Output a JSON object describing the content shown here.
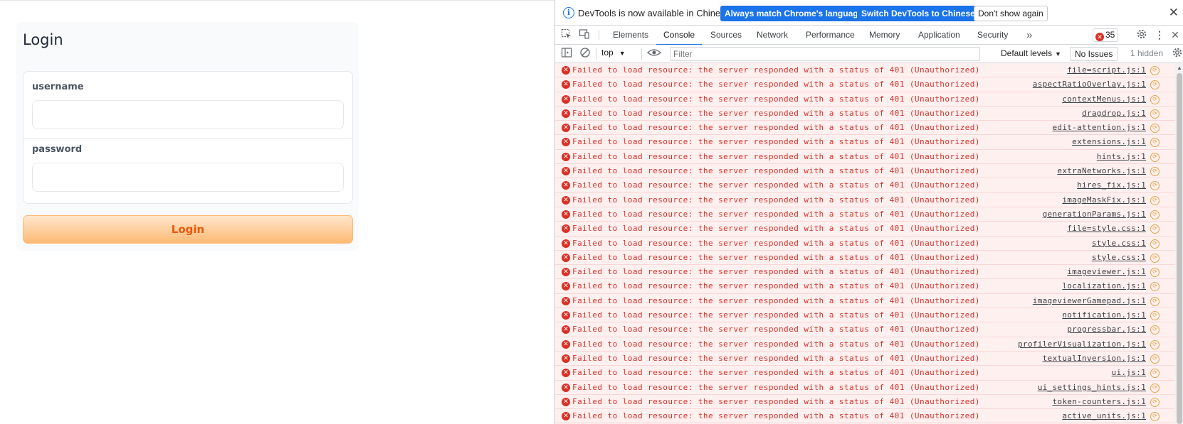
{
  "login": {
    "title": "Login",
    "username_label": "username",
    "username_value": "",
    "password_label": "password",
    "password_value": "",
    "button_label": "Login"
  },
  "devtools": {
    "infobar": {
      "message": "DevTools is now available in Chinese!",
      "match_language_button": "Always match Chrome's language",
      "switch_button": "Switch DevTools to Chinese",
      "dont_show_button": "Don't show again",
      "close_icon": "close-icon"
    },
    "tabs": [
      "Elements",
      "Console",
      "Sources",
      "Network",
      "Performance",
      "Memory",
      "Application",
      "Security"
    ],
    "active_tab": "Console",
    "more_tabs": "»",
    "error_count": "35",
    "toolbar": {
      "context": "top",
      "filter_placeholder": "Filter",
      "levels": "Default levels",
      "issues": "No Issues",
      "hidden": "1 hidden"
    },
    "colors": {
      "error_text": "#d93025",
      "error_bg": "#fff0f0",
      "accent": "#1a73e8"
    },
    "messages": [
      {
        "text": "Failed to load resource: the server responded with a status of 401 (Unauthorized)",
        "source": "file=script.js:1"
      },
      {
        "text": "Failed to load resource: the server responded with a status of 401 (Unauthorized)",
        "source": "aspectRatioOverlay.js:1"
      },
      {
        "text": "Failed to load resource: the server responded with a status of 401 (Unauthorized)",
        "source": "contextMenus.js:1"
      },
      {
        "text": "Failed to load resource: the server responded with a status of 401 (Unauthorized)",
        "source": "dragdrop.js:1"
      },
      {
        "text": "Failed to load resource: the server responded with a status of 401 (Unauthorized)",
        "source": "edit-attention.js:1"
      },
      {
        "text": "Failed to load resource: the server responded with a status of 401 (Unauthorized)",
        "source": "extensions.js:1"
      },
      {
        "text": "Failed to load resource: the server responded with a status of 401 (Unauthorized)",
        "source": "hints.js:1"
      },
      {
        "text": "Failed to load resource: the server responded with a status of 401 (Unauthorized)",
        "source": "extraNetworks.js:1"
      },
      {
        "text": "Failed to load resource: the server responded with a status of 401 (Unauthorized)",
        "source": "hires_fix.js:1"
      },
      {
        "text": "Failed to load resource: the server responded with a status of 401 (Unauthorized)",
        "source": "imageMaskFix.js:1"
      },
      {
        "text": "Failed to load resource: the server responded with a status of 401 (Unauthorized)",
        "source": "generationParams.js:1"
      },
      {
        "text": "Failed to load resource: the server responded with a status of 401 (Unauthorized)",
        "source": "file=style.css:1"
      },
      {
        "text": "Failed to load resource: the server responded with a status of 401 (Unauthorized)",
        "source": "style.css:1"
      },
      {
        "text": "Failed to load resource: the server responded with a status of 401 (Unauthorized)",
        "source": "style.css:1"
      },
      {
        "text": "Failed to load resource: the server responded with a status of 401 (Unauthorized)",
        "source": "imageviewer.js:1"
      },
      {
        "text": "Failed to load resource: the server responded with a status of 401 (Unauthorized)",
        "source": "localization.js:1"
      },
      {
        "text": "Failed to load resource: the server responded with a status of 401 (Unauthorized)",
        "source": "imageviewerGamepad.js:1"
      },
      {
        "text": "Failed to load resource: the server responded with a status of 401 (Unauthorized)",
        "source": "notification.js:1"
      },
      {
        "text": "Failed to load resource: the server responded with a status of 401 (Unauthorized)",
        "source": "progressbar.js:1"
      },
      {
        "text": "Failed to load resource: the server responded with a status of 401 (Unauthorized)",
        "source": "profilerVisualization.js:1"
      },
      {
        "text": "Failed to load resource: the server responded with a status of 401 (Unauthorized)",
        "source": "textualInversion.js:1"
      },
      {
        "text": "Failed to load resource: the server responded with a status of 401 (Unauthorized)",
        "source": "ui.js:1"
      },
      {
        "text": "Failed to load resource: the server responded with a status of 401 (Unauthorized)",
        "source": "ui_settings_hints.js:1"
      },
      {
        "text": "Failed to load resource: the server responded with a status of 401 (Unauthorized)",
        "source": "token-counters.js:1"
      },
      {
        "text": "Failed to load resource: the server responded with a status of 401 (Unauthorized)",
        "source": "active_units.js:1"
      }
    ]
  }
}
